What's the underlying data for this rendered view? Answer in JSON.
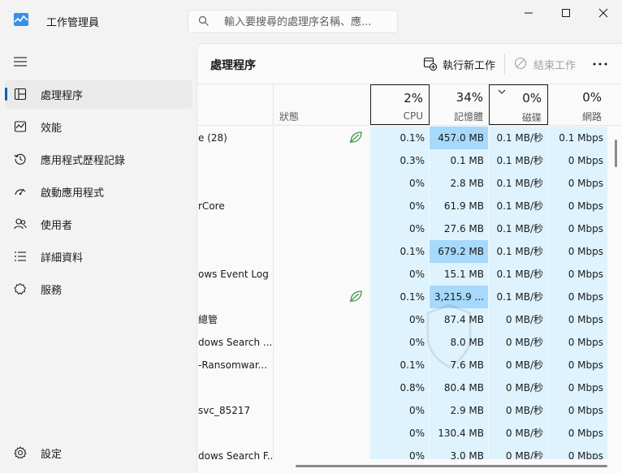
{
  "window": {
    "title": "工作管理員",
    "search_placeholder": "輸入要搜尋的處理序名稱、應..."
  },
  "sidebar": {
    "items": [
      {
        "label": "處理程序",
        "icon": "processes-icon",
        "active": true
      },
      {
        "label": "效能",
        "icon": "performance-icon",
        "active": false
      },
      {
        "label": "應用程式歷程記錄",
        "icon": "app-history-icon",
        "active": false
      },
      {
        "label": "啟動應用程式",
        "icon": "startup-apps-icon",
        "active": false
      },
      {
        "label": "使用者",
        "icon": "users-icon",
        "active": false
      },
      {
        "label": "詳細資料",
        "icon": "details-icon",
        "active": false
      },
      {
        "label": "服務",
        "icon": "services-icon",
        "active": false
      }
    ],
    "settings_label": "設定"
  },
  "toolbar": {
    "page_title": "處理程序",
    "run_new_task": "執行新工作",
    "end_task": "結束工作"
  },
  "columns": {
    "status": "狀態",
    "cpu": {
      "pct": "2%",
      "name": "CPU"
    },
    "memory": {
      "pct": "34%",
      "name": "記憶體"
    },
    "disk": {
      "pct": "0%",
      "name": "磁碟"
    },
    "network": {
      "pct": "0%",
      "name": "網路"
    }
  },
  "rows": [
    {
      "name": "e (28)",
      "eco": true,
      "cpu": "0.1%",
      "mem": "457.0 MB",
      "mem_hl": true,
      "disk": "0.1 MB/秒",
      "net": "0.1 Mbps"
    },
    {
      "name": "",
      "eco": false,
      "cpu": "0.3%",
      "mem": "0.1 MB",
      "mem_hl": false,
      "disk": "0.1 MB/秒",
      "net": "0 Mbps"
    },
    {
      "name": "",
      "eco": false,
      "cpu": "0%",
      "mem": "2.8 MB",
      "mem_hl": false,
      "disk": "0.1 MB/秒",
      "net": "0 Mbps"
    },
    {
      "name": "rCore",
      "eco": false,
      "cpu": "0%",
      "mem": "61.9 MB",
      "mem_hl": false,
      "disk": "0.1 MB/秒",
      "net": "0 Mbps"
    },
    {
      "name": "",
      "eco": false,
      "cpu": "0%",
      "mem": "27.6 MB",
      "mem_hl": false,
      "disk": "0.1 MB/秒",
      "net": "0 Mbps"
    },
    {
      "name": "",
      "eco": false,
      "cpu": "0.1%",
      "mem": "679.2 MB",
      "mem_hl": true,
      "disk": "0.1 MB/秒",
      "net": "0 Mbps"
    },
    {
      "name": "ows Event Log",
      "eco": false,
      "cpu": "0%",
      "mem": "15.1 MB",
      "mem_hl": false,
      "disk": "0.1 MB/秒",
      "net": "0 Mbps"
    },
    {
      "name": "",
      "eco": true,
      "cpu": "0.1%",
      "mem": "3,215.9 ...",
      "mem_hl": true,
      "disk": "0.1 MB/秒",
      "net": "0 Mbps"
    },
    {
      "name": "總管",
      "eco": false,
      "cpu": "0%",
      "mem": "87.4 MB",
      "mem_hl": false,
      "disk": "0 MB/秒",
      "net": "0 Mbps"
    },
    {
      "name": "dows Search ...",
      "eco": false,
      "cpu": "0%",
      "mem": "8.0 MB",
      "mem_hl": false,
      "disk": "0 MB/秒",
      "net": "0 Mbps"
    },
    {
      "name": "-Ransomwar...",
      "eco": false,
      "cpu": "0.1%",
      "mem": "7.6 MB",
      "mem_hl": false,
      "disk": "0 MB/秒",
      "net": "0 Mbps"
    },
    {
      "name": "",
      "eco": false,
      "cpu": "0.8%",
      "mem": "80.4 MB",
      "mem_hl": false,
      "disk": "0 MB/秒",
      "net": "0 Mbps"
    },
    {
      "name": "svc_85217",
      "eco": false,
      "cpu": "0%",
      "mem": "2.9 MB",
      "mem_hl": false,
      "disk": "0 MB/秒",
      "net": "0 Mbps"
    },
    {
      "name": "",
      "eco": false,
      "cpu": "0%",
      "mem": "130.4 MB",
      "mem_hl": false,
      "disk": "0 MB/秒",
      "net": "0 Mbps"
    },
    {
      "name": "dows Search F...",
      "eco": false,
      "cpu": "0%",
      "mem": "3.0 MB",
      "mem_hl": false,
      "disk": "0 MB/秒",
      "net": "0 Mbps"
    }
  ],
  "colors": {
    "accent": "#005fb8",
    "cell_bg": "#dff3fe",
    "cell_highlight": "#a6d9fb",
    "eco_leaf": "#3b8f3b"
  }
}
